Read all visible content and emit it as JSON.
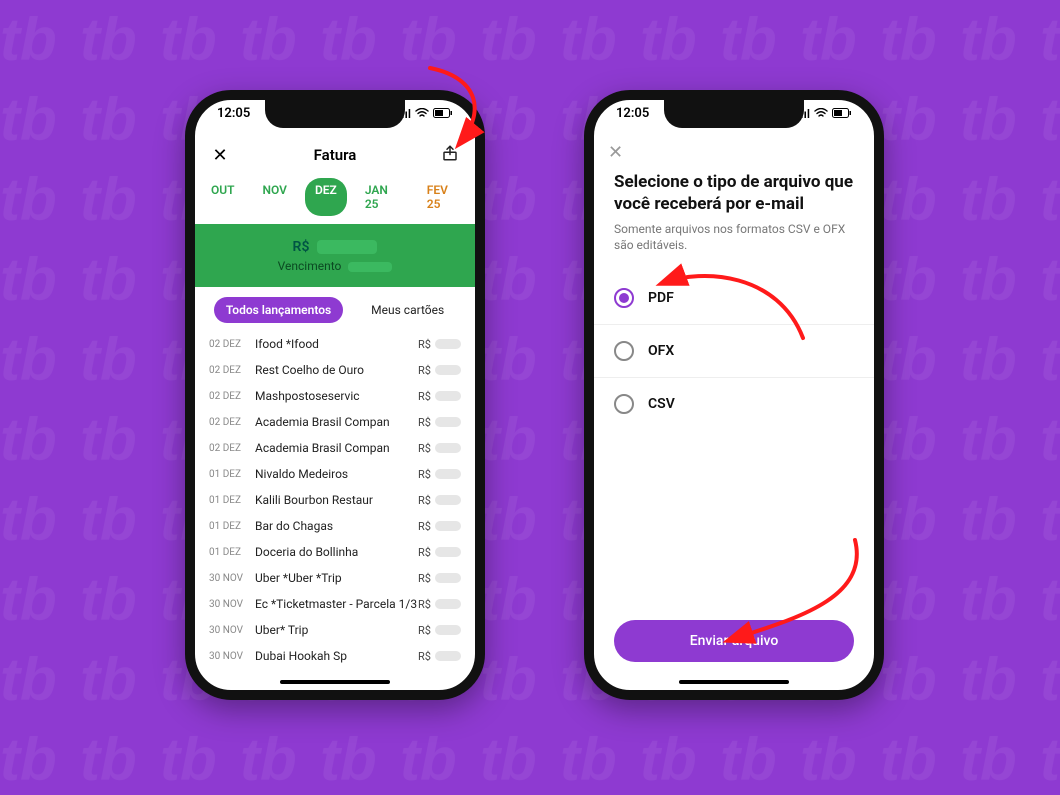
{
  "status": {
    "time": "12:05",
    "signal": "▪▪▪▪",
    "wifi": "📶",
    "battery": "🔋"
  },
  "left": {
    "header": {
      "close": "✕",
      "title": "Fatura",
      "shareIconName": "share-icon"
    },
    "months": [
      {
        "label": "OUT",
        "active": false,
        "style": "green"
      },
      {
        "label": "NOV",
        "active": false,
        "style": "green"
      },
      {
        "label": "DEZ",
        "active": true,
        "style": "green"
      },
      {
        "label": "JAN 25",
        "active": false,
        "style": "green"
      },
      {
        "label": "FEV 25",
        "active": false,
        "style": "orange"
      }
    ],
    "summary": {
      "amountPrefix": "R$",
      "dueLabel": "Vencimento"
    },
    "tabs": {
      "all": "Todos lançamentos",
      "cards": "Meus cartões"
    },
    "transactions": [
      {
        "date": "02 DEZ",
        "name": "Ifood *Ifood",
        "amt": "R$"
      },
      {
        "date": "02 DEZ",
        "name": "Rest Coelho de Ouro",
        "amt": "R$"
      },
      {
        "date": "02 DEZ",
        "name": "Mashpostoseservic",
        "amt": "R$"
      },
      {
        "date": "02 DEZ",
        "name": "Academia Brasil Compan",
        "amt": "R$"
      },
      {
        "date": "02 DEZ",
        "name": "Academia Brasil Compan",
        "amt": "R$"
      },
      {
        "date": "01 DEZ",
        "name": "Nivaldo Medeiros",
        "amt": "R$"
      },
      {
        "date": "01 DEZ",
        "name": "Kalili Bourbon Restaur",
        "amt": "R$"
      },
      {
        "date": "01 DEZ",
        "name": "Bar do Chagas",
        "amt": "R$"
      },
      {
        "date": "01 DEZ",
        "name": "Doceria do Bollinha",
        "amt": "R$"
      },
      {
        "date": "30 NOV",
        "name": "Uber *Uber *Trip",
        "amt": "R$"
      },
      {
        "date": "30 NOV",
        "name": "Ec *Ticketmaster - Parcela 1/3",
        "amt": "R$"
      },
      {
        "date": "30 NOV",
        "name": "Uber* Trip",
        "amt": "R$"
      },
      {
        "date": "30 NOV",
        "name": "Dubai Hookah Sp",
        "amt": "R$"
      }
    ]
  },
  "right": {
    "close": "✕",
    "title": "Selecione o tipo de arquivo que você receberá por e-mail",
    "subtitle": "Somente arquivos nos formatos CSV e OFX são editáveis.",
    "options": [
      {
        "label": "PDF",
        "selected": true
      },
      {
        "label": "OFX",
        "selected": false
      },
      {
        "label": "CSV",
        "selected": false
      }
    ],
    "button": "Enviar arquivo"
  }
}
